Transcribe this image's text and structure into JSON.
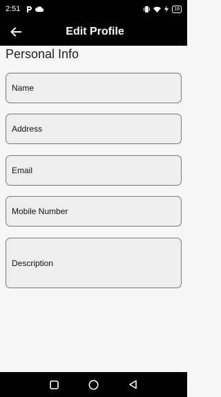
{
  "status_bar": {
    "time": "2:51",
    "battery": "18"
  },
  "app_bar": {
    "title": "Edit Profile"
  },
  "section": {
    "title": "Personal Info"
  },
  "fields": {
    "name": "Name",
    "address": "Address",
    "email": "Email",
    "mobile": "Mobile Number",
    "description": "Description"
  },
  "icons": {
    "back": "arrow-back-icon",
    "nav_recent": "square-icon",
    "nav_home": "circle-icon",
    "nav_back": "triangle-back-icon"
  },
  "colors": {
    "bar": "#000000",
    "background": "#f6f6f6",
    "field_fill": "#efefef",
    "field_border": "#7a7a7a"
  }
}
